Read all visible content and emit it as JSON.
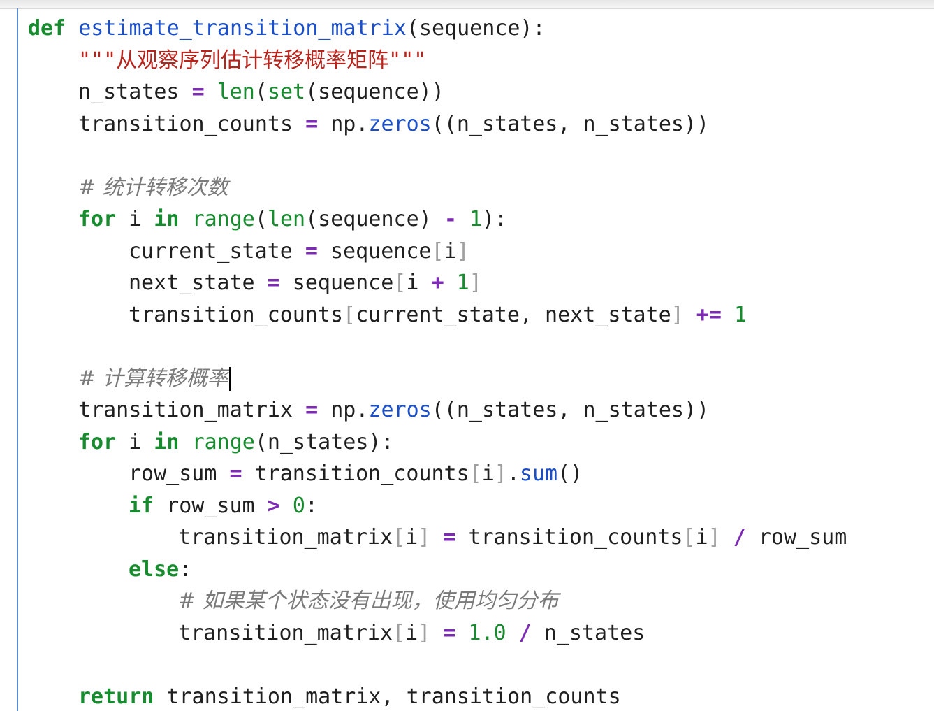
{
  "editor": {
    "lines": {
      "l1": {
        "kw": "def",
        "fname": "estimate_transition_matrix",
        "rest": "(sequence):"
      },
      "l2": {
        "docstring": "\"\"\"从观察序列估计转移概率矩阵\"\"\""
      },
      "l3": {
        "a": "n_states ",
        "op": "=",
        "b": " ",
        "f1": "len",
        "c": "(",
        "f2": "set",
        "d": "(sequence))"
      },
      "l4": {
        "a": "transition_counts ",
        "op": "=",
        "b": " np.",
        "m": "zeros",
        "c": "((n_states, n_states))"
      },
      "l6": {
        "comment": "# 统计转移次数"
      },
      "l7": {
        "kw1": "for",
        "a": " i ",
        "kw2": "in",
        "b": " ",
        "f1": "range",
        "c": "(",
        "f2": "len",
        "d": "(sequence) ",
        "op": "-",
        "e": " ",
        "num": "1",
        "f": "):"
      },
      "l8": {
        "a": "current_state ",
        "op": "=",
        "b": " sequence",
        "lb": "[",
        "c": "i",
        "rb": "]"
      },
      "l9": {
        "a": "next_state ",
        "op1": "=",
        "b": " sequence",
        "lb": "[",
        "c": "i ",
        "op2": "+",
        "d": " ",
        "num": "1",
        "rb": "]"
      },
      "l10": {
        "a": "transition_counts",
        "lb": "[",
        "b": "current_state, next_state",
        "rb": "]",
        "c": " ",
        "op": "+=",
        "d": " ",
        "num": "1"
      },
      "l12": {
        "comment": "# 计算转移概率"
      },
      "l13": {
        "a": "transition_matrix ",
        "op": "=",
        "b": " np.",
        "m": "zeros",
        "c": "((n_states, n_states))"
      },
      "l14": {
        "kw1": "for",
        "a": " i ",
        "kw2": "in",
        "b": " ",
        "f1": "range",
        "c": "(n_states):"
      },
      "l15": {
        "a": "row_sum ",
        "op": "=",
        "b": " transition_counts",
        "lb": "[",
        "c": "i",
        "rb": "]",
        "d": ".",
        "m": "sum",
        "e": "()"
      },
      "l16": {
        "kw": "if",
        "a": " row_sum ",
        "op": ">",
        "b": " ",
        "num": "0",
        "c": ":"
      },
      "l17": {
        "a": "transition_matrix",
        "lb1": "[",
        "b": "i",
        "rb1": "]",
        "c": " ",
        "op1": "=",
        "d": " transition_counts",
        "lb2": "[",
        "e": "i",
        "rb2": "]",
        "f": " ",
        "op2": "/",
        "g": " row_sum"
      },
      "l18": {
        "kw": "else",
        "a": ":"
      },
      "l19": {
        "comment": "# 如果某个状态没有出现，使用均匀分布"
      },
      "l20": {
        "a": "transition_matrix",
        "lb": "[",
        "b": "i",
        "rb": "]",
        "c": " ",
        "op1": "=",
        "d": " ",
        "num": "1.0",
        "e": " ",
        "op2": "/",
        "f": " n_states"
      },
      "l22": {
        "kw": "return",
        "a": " transition_matrix, transition_counts"
      }
    }
  }
}
